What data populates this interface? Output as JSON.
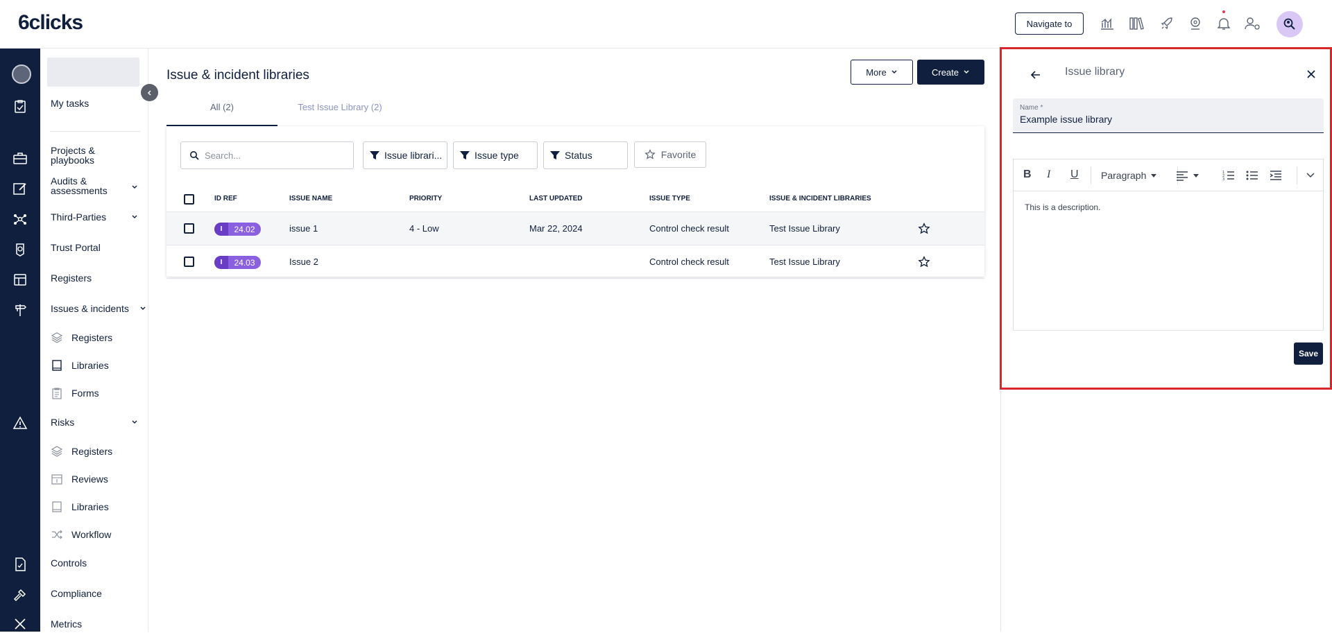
{
  "header": {
    "logo": "6clicks",
    "navigate_to": "Navigate to",
    "icons": [
      "analytics-icon",
      "library-icon",
      "rocket-icon",
      "support-icon",
      "bell-icon",
      "user-settings-icon",
      "search-avatar-icon"
    ]
  },
  "sidebar": {
    "my_tasks": "My tasks",
    "items": {
      "projects": "Projects & playbooks",
      "audits": "Audits & assessments",
      "third_parties": "Third-Parties",
      "trust_portal": "Trust Portal",
      "registers": "Registers",
      "issues": "Issues & incidents",
      "issues_registers": "Registers",
      "issues_libraries": "Libraries",
      "issues_forms": "Forms",
      "risks": "Risks",
      "risks_registers": "Registers",
      "risks_reviews": "Reviews",
      "risks_libraries": "Libraries",
      "risks_workflow": "Workflow",
      "controls": "Controls",
      "compliance": "Compliance",
      "metrics": "Metrics"
    }
  },
  "main": {
    "title": "Issue & incident libraries",
    "more_label": "More",
    "create_label": "Create",
    "tabs": [
      {
        "label": "All (2)"
      },
      {
        "label": "Test Issue Library (2)"
      }
    ],
    "search_placeholder": "Search...",
    "filters": [
      "Issue librari...",
      "Issue type",
      "Status"
    ],
    "favorite_label": "Favorite",
    "columns": [
      "ID REF",
      "ISSUE NAME",
      "PRIORITY",
      "LAST UPDATED",
      "ISSUE TYPE",
      "ISSUE & INCIDENT LIBRARIES"
    ],
    "rows": [
      {
        "badge_letter": "I",
        "id_ref": "24.02",
        "name": "issue 1",
        "priority": "4 - Low",
        "last_updated": "Mar 22, 2024",
        "issue_type": "Control check result",
        "library": "Test Issue Library"
      },
      {
        "badge_letter": "I",
        "id_ref": "24.03",
        "name": "Issue 2",
        "priority": "",
        "last_updated": "",
        "issue_type": "Control check result",
        "library": "Test Issue Library"
      }
    ]
  },
  "panel": {
    "title": "Issue library",
    "name_label": "Name *",
    "name_value": "Example issue library",
    "toolbar": {
      "bold": "B",
      "italic": "I",
      "underline": "U",
      "paragraph": "Paragraph"
    },
    "description": "This is a description.",
    "save_label": "Save"
  },
  "colors": {
    "navy": "#0f1f3d",
    "badge_purple": "#8a5fe0",
    "highlight_red": "#d9262a"
  }
}
